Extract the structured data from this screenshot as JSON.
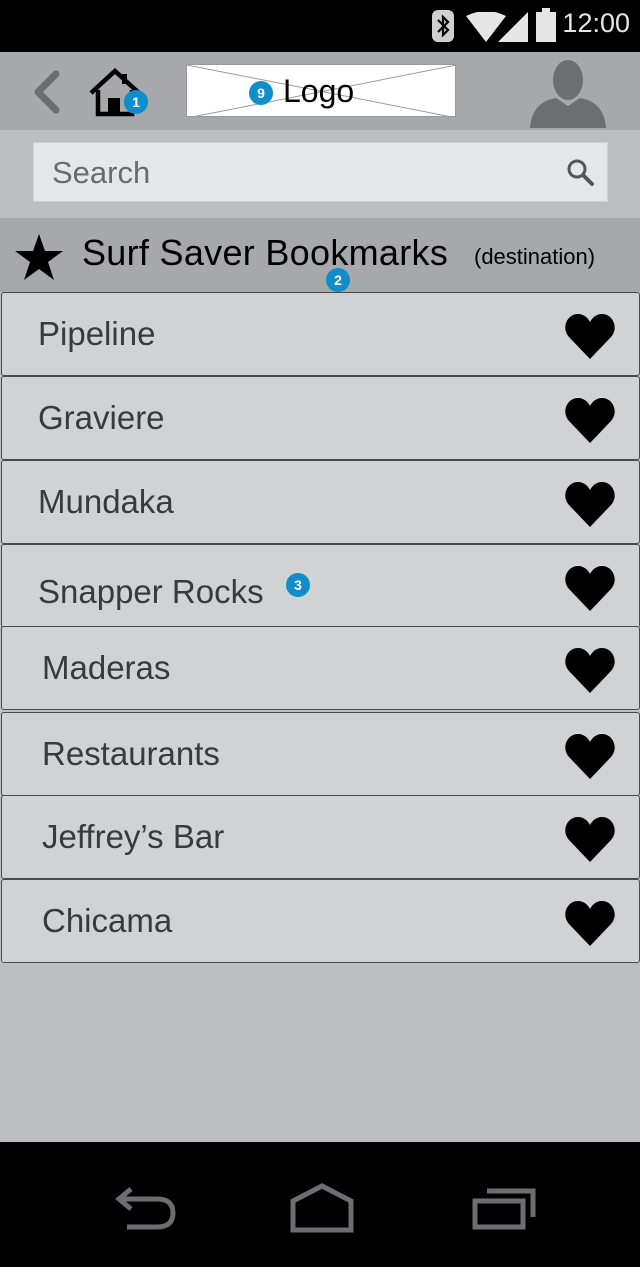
{
  "status": {
    "time": "12:00"
  },
  "header": {
    "logo_text": "Logo",
    "badge_home": "1",
    "badge_logo": "9"
  },
  "search": {
    "placeholder": "Search"
  },
  "section": {
    "title": "Surf Saver Bookmarks",
    "subtitle": "(destination)",
    "badge": "2"
  },
  "bookmarks": [
    {
      "label": "Pipeline"
    },
    {
      "label": "Graviere"
    },
    {
      "label": "Mundaka"
    },
    {
      "label": "Snapper Rocks",
      "badge": "3"
    },
    {
      "label": "Maderas"
    },
    {
      "label": "Restaurants"
    },
    {
      "label": "Jeffrey’s Bar"
    },
    {
      "label": "Chicama"
    }
  ],
  "icons": {
    "bluetooth": "bluetooth-icon",
    "wifi": "wifi-icon",
    "signal": "signal-icon",
    "battery": "battery-icon",
    "back": "back-icon",
    "home": "home-icon",
    "avatar": "avatar-icon",
    "search": "search-icon",
    "star": "star-icon",
    "heart": "heart-icon",
    "nav_back": "nav-back-icon",
    "nav_home": "nav-home-icon",
    "nav_recents": "nav-recents-icon"
  },
  "colors": {
    "badge": "#0f8ec9",
    "header_bg": "#a7a8ab",
    "list_bg": "#d1d2d4",
    "app_bg": "#bdbec2"
  }
}
